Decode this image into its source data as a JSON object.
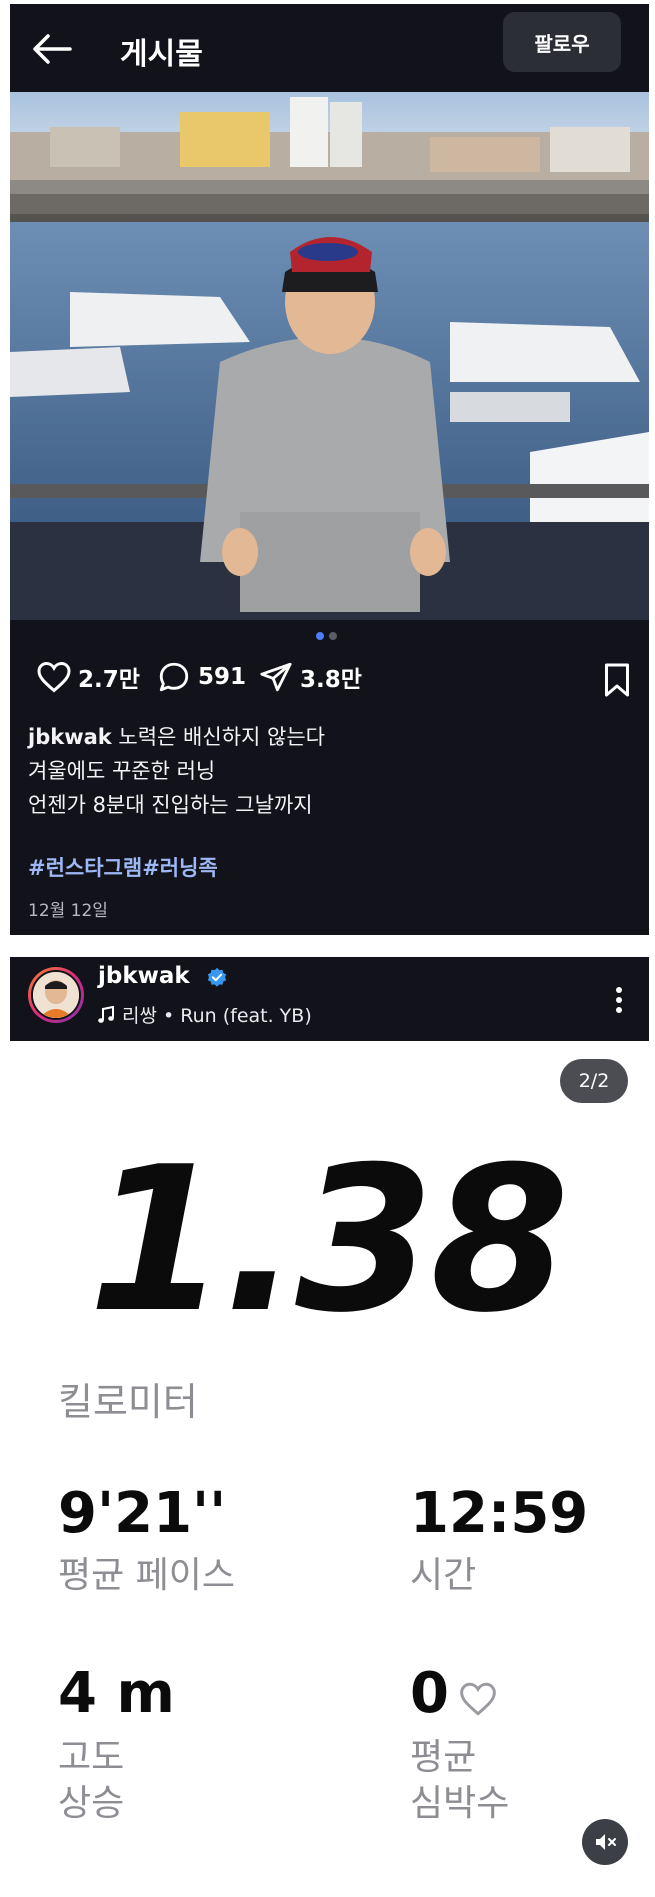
{
  "post": {
    "title": "게시물",
    "follow_label": "팔로우",
    "likes": "2.7만",
    "comments": "591",
    "shares": "3.8만",
    "caption_user": "jbkwak",
    "caption_line1": "노력은 배신하지 않는다",
    "caption_line2": "겨울에도 꾸준한 러닝",
    "caption_line3": "언젠가 8분대 진입하는 그날까지",
    "hashtags": "#런스타그램#러닝족",
    "date": "12월 12일"
  },
  "reel": {
    "username": "jbkwak",
    "music": "리쌍 • Run (feat. YB)",
    "page_indicator": "2/2",
    "distance": "1.38",
    "distance_unit": "킬로미터",
    "pace_value": "9'21''",
    "pace_label": "평균 페이스",
    "time_value": "12:59",
    "time_label": "시간",
    "elevation_value": "4 m",
    "elevation_label_1": "고도",
    "elevation_label_2": "상승",
    "heart_value": "0",
    "heart_label_1": "평균",
    "heart_label_2": "심박수"
  },
  "icons": {
    "back": "arrow-left-icon",
    "like": "heart-icon",
    "comment": "comment-icon",
    "share": "send-icon",
    "save": "bookmark-icon",
    "mute": "speaker-muted-icon",
    "verified": "verified-badge-icon",
    "music": "music-note-icon",
    "more": "more-vertical-icon"
  },
  "colors": {
    "dark_bg": "#12131a",
    "hashtag": "#9db8f5",
    "verified": "#3897f0",
    "active_dot": "#4c7cf6"
  }
}
